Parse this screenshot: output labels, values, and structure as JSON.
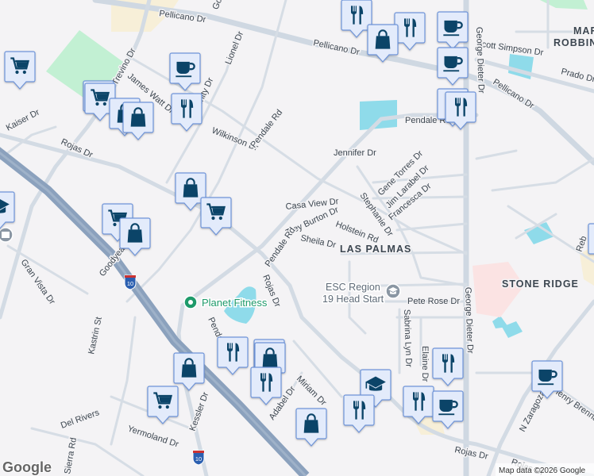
{
  "map": {
    "streets": {
      "pellicano_1": "Pellicano Dr",
      "pellicano_2": "Pellicano Dr",
      "pellicano_3": "Pellicano Dr",
      "scott_simpson": "Scott Simpson Dr",
      "prado": "Prado Dr",
      "trevino": "Trevino Dr",
      "james_watt": "James Watt Dr",
      "trinity": "Trinity Dr",
      "lionel": "Lionel Dr",
      "goodyear_1": "Goodyear Dr",
      "goodyear_2": "Goodyear Dr",
      "kaiser": "Kaiser Dr",
      "rojas_1": "Rojas Dr",
      "rojas_2": "Rojas Dr",
      "rojas_3": "Rojas Dr",
      "rojas_4": "Rojas Dr",
      "wilkinson": "Wilkinson Dr",
      "pendale_1": "Pendale Rd",
      "pendale_2": "Pendale Rd",
      "pendale_3": "Pendale Rd",
      "pendale_4": "Pendale Rd",
      "jennifer": "Jennifer Dr",
      "george_dieter_1": "George Dieter Dr",
      "george_dieter_2": "George Dieter Dr",
      "gene_torres": "Gene Torres Dr",
      "jim_larabel": "Jim Larabel Dr",
      "francesca": "Francesca Dr",
      "stephanie": "Stephanie Dr",
      "casa_view": "Casa View Dr",
      "trey_burton": "Trey Burton Dr",
      "holstein": "Holstein Rd",
      "sheila": "Sheila Dr",
      "gran_vista": "Gran Vista Dr",
      "kastrin": "Kastrin St",
      "pete_rose": "Pete Rose Dr",
      "sabrina_lyn": "Sabrina Lyn Dr",
      "elaine": "Elaine Dr",
      "miriam": "Miriam Dr",
      "adabel": "Adabel Dr",
      "kessler": "Kessler Dr",
      "yermoland": "Yermoland Dr",
      "del_rivers": "Del Rivers",
      "n_zaragoza": "N Zaragoza Rd",
      "henry_brennan": "Henry Brennan",
      "reb": "Reb",
      "sierra": "Sierra Rd"
    },
    "areas": {
      "mar_robbins_1": "MAR",
      "mar_robbins_2": "ROBBINS",
      "las_palmas": "LAS PALMAS",
      "stone_ridge": "STONE RIDGE"
    },
    "places": {
      "planet_fitness": "Planet Fitness",
      "esc_line1": "ESC Region",
      "esc_line2": "19 Head Start"
    },
    "highway_shield": "10",
    "attribution": "Map data ©2026 Google",
    "logo": "Google",
    "colors": {
      "marker_fill": "#e3ebfb",
      "marker_border": "#6f95da",
      "icon": "#0b4468",
      "water": "#8fdbea",
      "park": "#c2f0d3",
      "highway": "#8ba1bd"
    }
  }
}
